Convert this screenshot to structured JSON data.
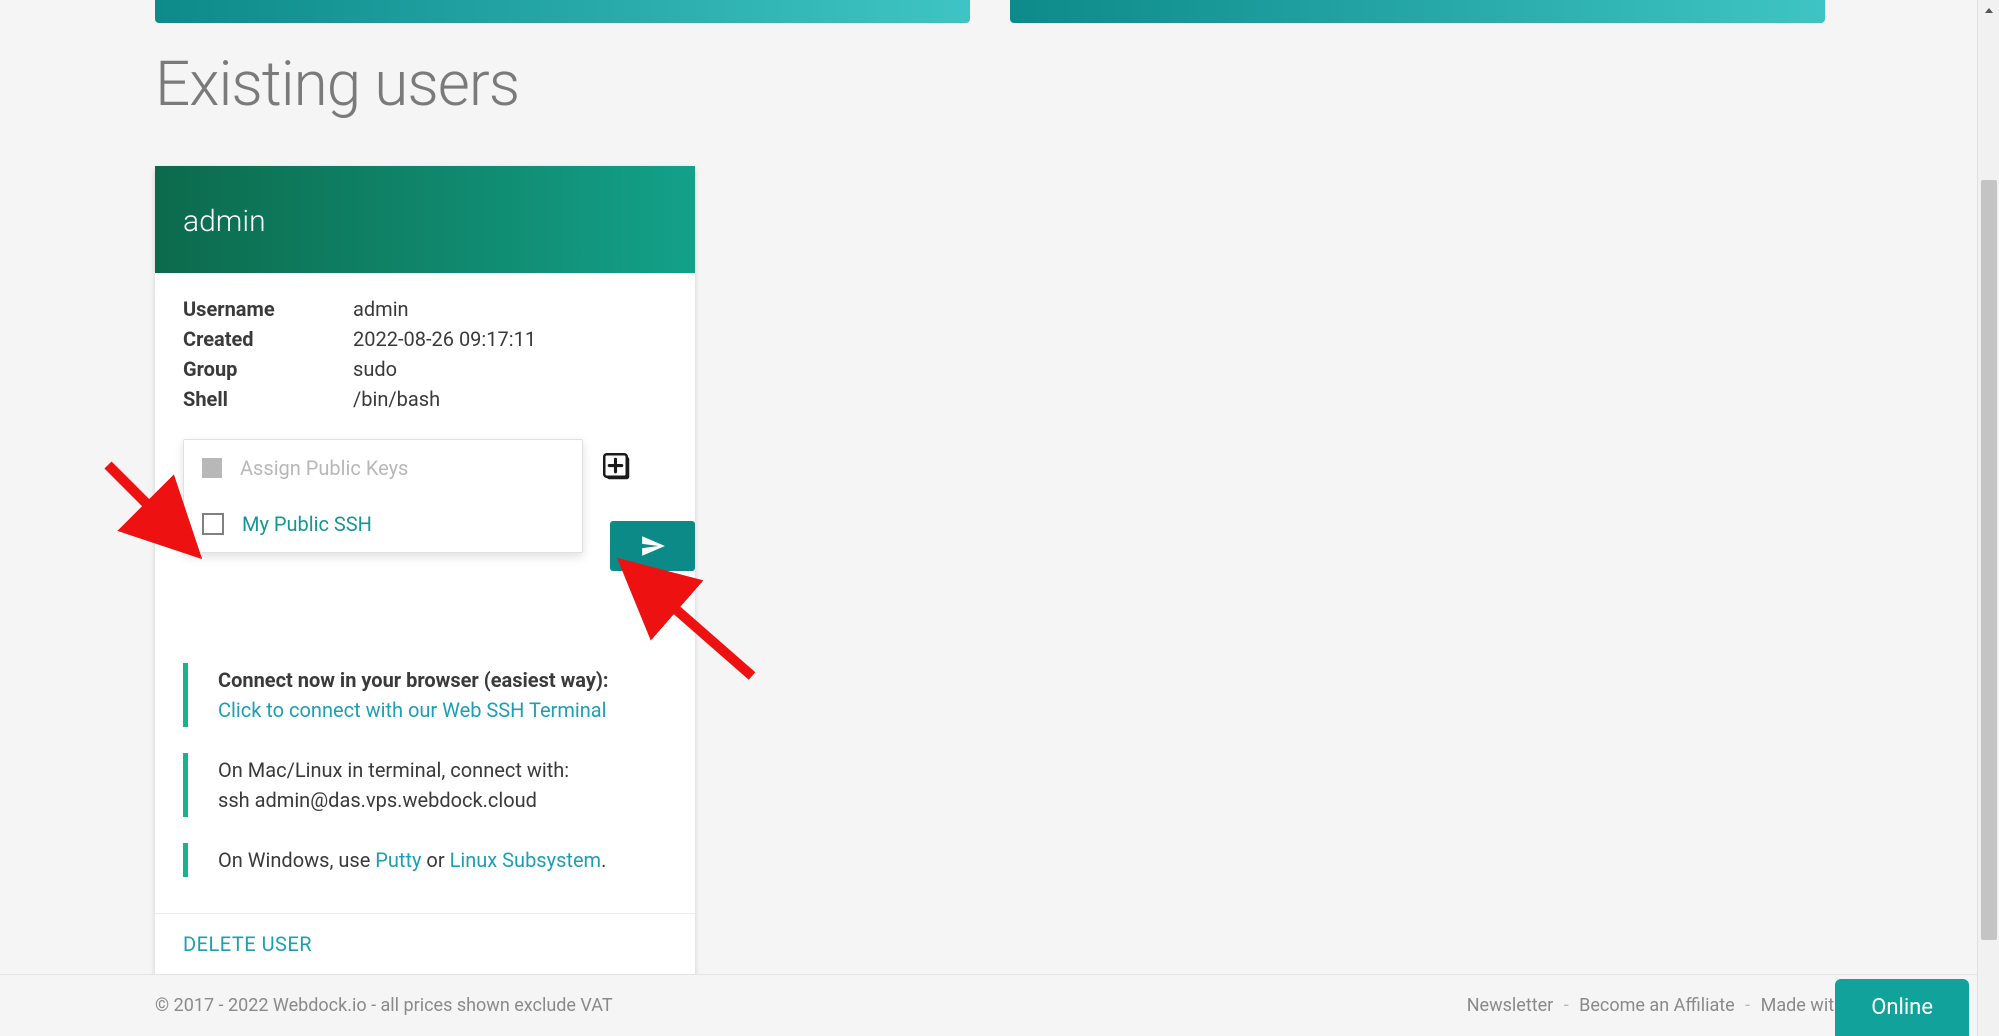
{
  "page": {
    "title": "Existing users"
  },
  "user_card": {
    "name": "admin",
    "fields": {
      "username_label": "Username",
      "username_value": "admin",
      "created_label": "Created",
      "created_value": "2022-08-26 09:17:11",
      "group_label": "Group",
      "group_value": "sudo",
      "shell_label": "Shell",
      "shell_value": "/bin/bash"
    },
    "assign_keys": {
      "header": "Assign Public Keys",
      "option_label": "My Public SSH"
    },
    "connect": {
      "browser_bold": "Connect now in your browser (easiest way):",
      "browser_link": "Click to connect with our Web SSH Terminal",
      "mac_line1": "On Mac/Linux in terminal, connect with:",
      "mac_line2": "ssh admin@das.vps.webdock.cloud",
      "win_prefix": "On Windows, use ",
      "win_putty": "Putty",
      "win_mid": " or ",
      "win_linuxsub": "Linux Subsystem",
      "win_suffix": "."
    },
    "delete_label": "DELETE USER"
  },
  "footer": {
    "copyright": "© 2017 - 2022 Webdock.io - all prices shown exclude VAT",
    "links": {
      "newsletter": "Newsletter",
      "affiliate": "Become an Affiliate",
      "madewith": "Made with"
    }
  },
  "status_badge": {
    "label": "Online"
  },
  "colors": {
    "teal": "#0b8a87",
    "link": "#1d9fb3",
    "accent_green": "#1bb18a"
  }
}
